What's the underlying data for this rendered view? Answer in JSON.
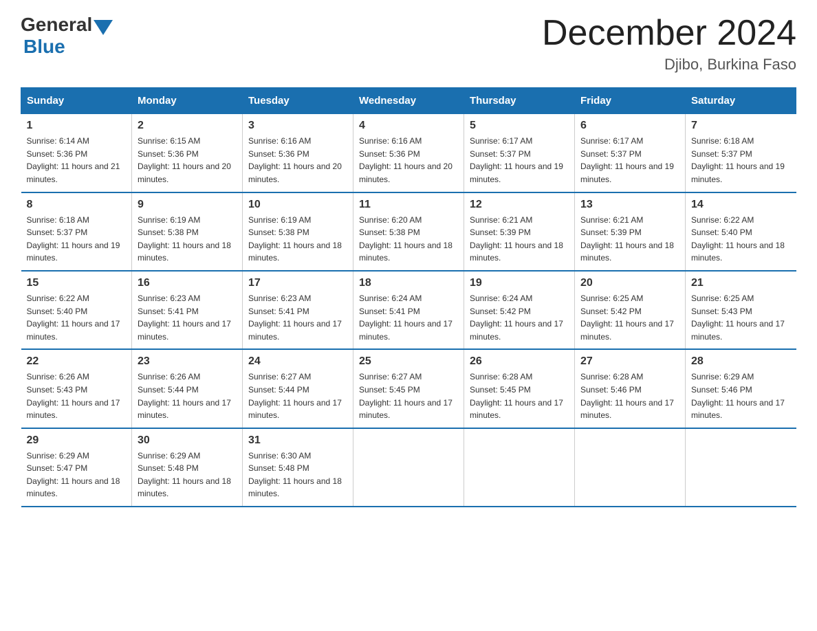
{
  "header": {
    "logo_general": "General",
    "logo_blue": "Blue",
    "month_title": "December 2024",
    "location": "Djibo, Burkina Faso"
  },
  "days_of_week": [
    "Sunday",
    "Monday",
    "Tuesday",
    "Wednesday",
    "Thursday",
    "Friday",
    "Saturday"
  ],
  "weeks": [
    [
      {
        "day": "1",
        "sunrise": "6:14 AM",
        "sunset": "5:36 PM",
        "daylight": "11 hours and 21 minutes."
      },
      {
        "day": "2",
        "sunrise": "6:15 AM",
        "sunset": "5:36 PM",
        "daylight": "11 hours and 20 minutes."
      },
      {
        "day": "3",
        "sunrise": "6:16 AM",
        "sunset": "5:36 PM",
        "daylight": "11 hours and 20 minutes."
      },
      {
        "day": "4",
        "sunrise": "6:16 AM",
        "sunset": "5:36 PM",
        "daylight": "11 hours and 20 minutes."
      },
      {
        "day": "5",
        "sunrise": "6:17 AM",
        "sunset": "5:37 PM",
        "daylight": "11 hours and 19 minutes."
      },
      {
        "day": "6",
        "sunrise": "6:17 AM",
        "sunset": "5:37 PM",
        "daylight": "11 hours and 19 minutes."
      },
      {
        "day": "7",
        "sunrise": "6:18 AM",
        "sunset": "5:37 PM",
        "daylight": "11 hours and 19 minutes."
      }
    ],
    [
      {
        "day": "8",
        "sunrise": "6:18 AM",
        "sunset": "5:37 PM",
        "daylight": "11 hours and 19 minutes."
      },
      {
        "day": "9",
        "sunrise": "6:19 AM",
        "sunset": "5:38 PM",
        "daylight": "11 hours and 18 minutes."
      },
      {
        "day": "10",
        "sunrise": "6:19 AM",
        "sunset": "5:38 PM",
        "daylight": "11 hours and 18 minutes."
      },
      {
        "day": "11",
        "sunrise": "6:20 AM",
        "sunset": "5:38 PM",
        "daylight": "11 hours and 18 minutes."
      },
      {
        "day": "12",
        "sunrise": "6:21 AM",
        "sunset": "5:39 PM",
        "daylight": "11 hours and 18 minutes."
      },
      {
        "day": "13",
        "sunrise": "6:21 AM",
        "sunset": "5:39 PM",
        "daylight": "11 hours and 18 minutes."
      },
      {
        "day": "14",
        "sunrise": "6:22 AM",
        "sunset": "5:40 PM",
        "daylight": "11 hours and 18 minutes."
      }
    ],
    [
      {
        "day": "15",
        "sunrise": "6:22 AM",
        "sunset": "5:40 PM",
        "daylight": "11 hours and 17 minutes."
      },
      {
        "day": "16",
        "sunrise": "6:23 AM",
        "sunset": "5:41 PM",
        "daylight": "11 hours and 17 minutes."
      },
      {
        "day": "17",
        "sunrise": "6:23 AM",
        "sunset": "5:41 PM",
        "daylight": "11 hours and 17 minutes."
      },
      {
        "day": "18",
        "sunrise": "6:24 AM",
        "sunset": "5:41 PM",
        "daylight": "11 hours and 17 minutes."
      },
      {
        "day": "19",
        "sunrise": "6:24 AM",
        "sunset": "5:42 PM",
        "daylight": "11 hours and 17 minutes."
      },
      {
        "day": "20",
        "sunrise": "6:25 AM",
        "sunset": "5:42 PM",
        "daylight": "11 hours and 17 minutes."
      },
      {
        "day": "21",
        "sunrise": "6:25 AM",
        "sunset": "5:43 PM",
        "daylight": "11 hours and 17 minutes."
      }
    ],
    [
      {
        "day": "22",
        "sunrise": "6:26 AM",
        "sunset": "5:43 PM",
        "daylight": "11 hours and 17 minutes."
      },
      {
        "day": "23",
        "sunrise": "6:26 AM",
        "sunset": "5:44 PM",
        "daylight": "11 hours and 17 minutes."
      },
      {
        "day": "24",
        "sunrise": "6:27 AM",
        "sunset": "5:44 PM",
        "daylight": "11 hours and 17 minutes."
      },
      {
        "day": "25",
        "sunrise": "6:27 AM",
        "sunset": "5:45 PM",
        "daylight": "11 hours and 17 minutes."
      },
      {
        "day": "26",
        "sunrise": "6:28 AM",
        "sunset": "5:45 PM",
        "daylight": "11 hours and 17 minutes."
      },
      {
        "day": "27",
        "sunrise": "6:28 AM",
        "sunset": "5:46 PM",
        "daylight": "11 hours and 17 minutes."
      },
      {
        "day": "28",
        "sunrise": "6:29 AM",
        "sunset": "5:46 PM",
        "daylight": "11 hours and 17 minutes."
      }
    ],
    [
      {
        "day": "29",
        "sunrise": "6:29 AM",
        "sunset": "5:47 PM",
        "daylight": "11 hours and 18 minutes."
      },
      {
        "day": "30",
        "sunrise": "6:29 AM",
        "sunset": "5:48 PM",
        "daylight": "11 hours and 18 minutes."
      },
      {
        "day": "31",
        "sunrise": "6:30 AM",
        "sunset": "5:48 PM",
        "daylight": "11 hours and 18 minutes."
      },
      {
        "day": "",
        "sunrise": "",
        "sunset": "",
        "daylight": ""
      },
      {
        "day": "",
        "sunrise": "",
        "sunset": "",
        "daylight": ""
      },
      {
        "day": "",
        "sunrise": "",
        "sunset": "",
        "daylight": ""
      },
      {
        "day": "",
        "sunrise": "",
        "sunset": "",
        "daylight": ""
      }
    ]
  ]
}
